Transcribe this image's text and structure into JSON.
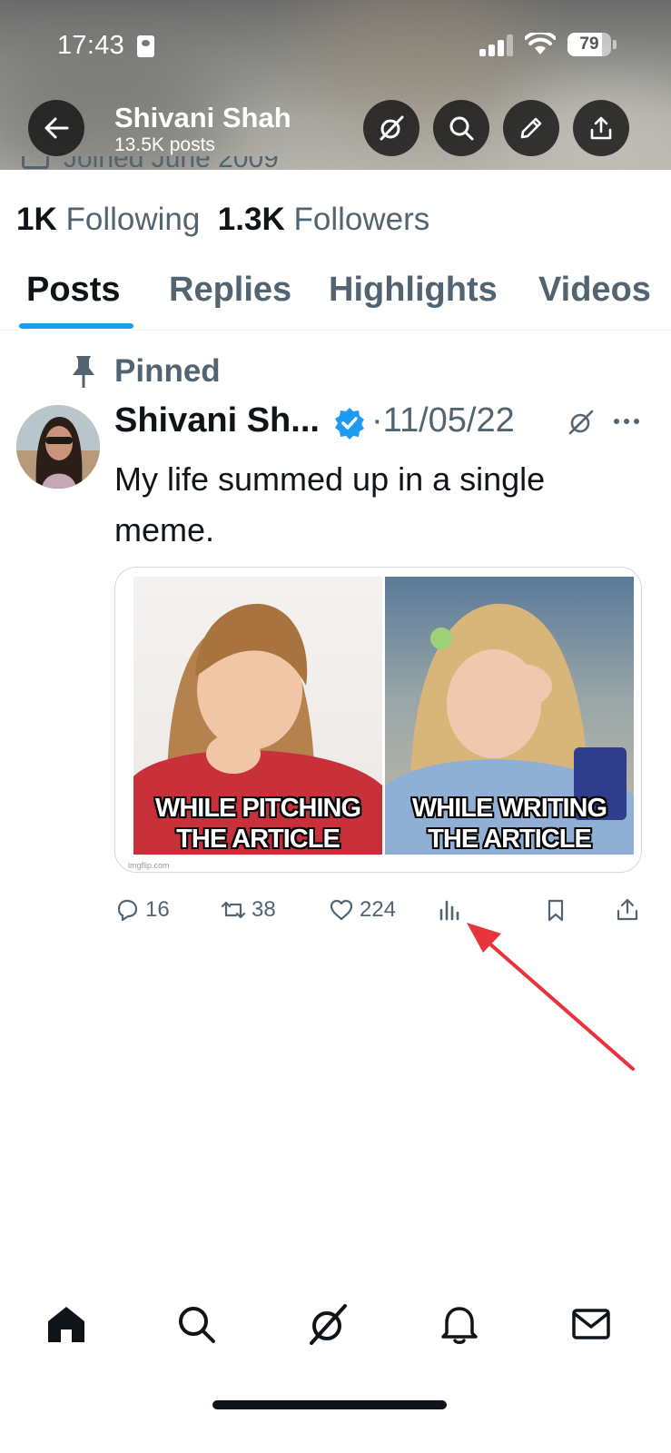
{
  "status_bar": {
    "time": "17:43",
    "battery": "79",
    "battery_level": 0.79
  },
  "header": {
    "name": "Shivani Shah",
    "posts_count": "13.5K posts",
    "joined_peek": "Joined June 2009"
  },
  "profile_stats": {
    "following_count": "1K",
    "following_label": "Following",
    "followers_count": "1.3K",
    "followers_label": "Followers"
  },
  "tabs": [
    {
      "label": "Posts",
      "active": true
    },
    {
      "label": "Replies"
    },
    {
      "label": "Highlights"
    },
    {
      "label": "Videos"
    }
  ],
  "post": {
    "pinned_label": "Pinned",
    "author": "Shivani Sh...",
    "date": "·11/05/22",
    "text": "My life summed up in a single meme.",
    "media": {
      "left_caption": "WHILE PITCHING THE ARTICLE",
      "right_caption": "WHILE WRITING THE ARTICLE",
      "watermark": "imgflip.com"
    },
    "actions": {
      "replies": "16",
      "reposts": "38",
      "likes": "224"
    }
  },
  "colors": {
    "accent": "#1d9bf0",
    "annotation_arrow": "#e8323c",
    "muted_text": "#536471"
  },
  "icons": {
    "header": [
      "back-arrow-icon",
      "grok-icon",
      "search-icon",
      "edit-icon",
      "share-icon"
    ],
    "actions": [
      "reply-icon",
      "repost-icon",
      "like-icon",
      "views-icon",
      "bookmark-icon",
      "share-icon"
    ],
    "nav": [
      "home-icon",
      "search-icon",
      "grok-icon",
      "notifications-icon",
      "messages-icon"
    ]
  }
}
